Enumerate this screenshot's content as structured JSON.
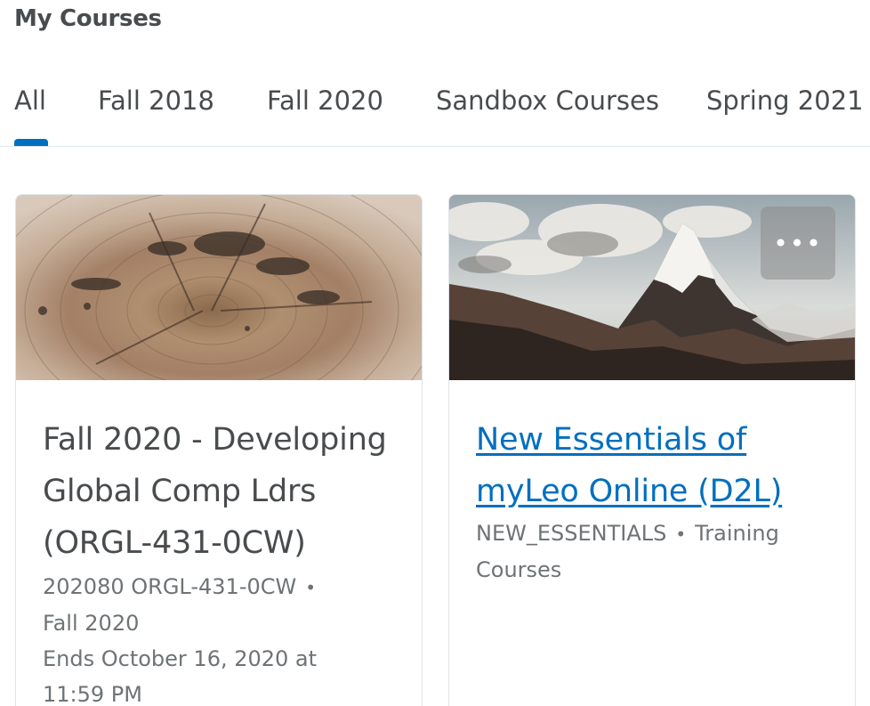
{
  "page_title": "My Courses",
  "tabs": [
    {
      "label": "All",
      "active": true
    },
    {
      "label": "Fall 2018",
      "active": false
    },
    {
      "label": "Fall 2020",
      "active": false
    },
    {
      "label": "Sandbox Courses",
      "active": false
    },
    {
      "label": "Spring 2021",
      "active": false
    }
  ],
  "colors": {
    "accent": "#006fbf",
    "text": "#494c4e",
    "meta": "#6e7376"
  },
  "courses": [
    {
      "title_lines": [
        "Fall 2020 - Developing",
        "Global Comp Ldrs",
        "(ORGL-431-0CW)"
      ],
      "code": "202080 ORGL-431-0CW",
      "separator": "•",
      "semester": "Fall 2020",
      "end_date": "Ends October 16, 2020 at",
      "end_time": "11:59 PM",
      "image": "wood-rings-image"
    },
    {
      "title_lines": [
        "New Essentials of",
        "myLeo Online (D2L)"
      ],
      "code": "NEW_ESSENTIALS",
      "separator": "•",
      "category": "Training",
      "category_cont": "Courses",
      "image": "mountain-image",
      "menu_icon": "ellipsis-icon",
      "menu_label": "•••"
    }
  ]
}
